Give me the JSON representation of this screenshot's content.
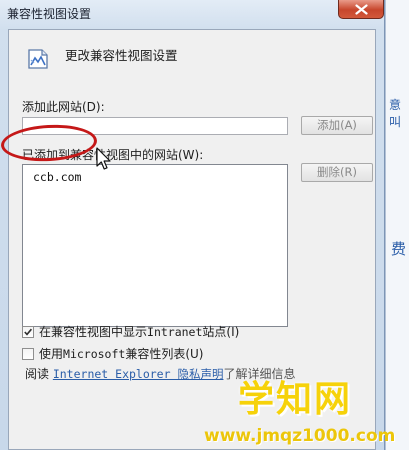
{
  "window": {
    "title": "兼容性视图设置"
  },
  "header": {
    "text": "更改兼容性视图设置"
  },
  "add_site": {
    "label": "添加此网站(D):",
    "input_value": "",
    "add_button": "添加(A)"
  },
  "site_list": {
    "label": "已添加到兼容性视图中的网站(W):",
    "items": [
      "ccb.com"
    ],
    "delete_button": "删除(R)"
  },
  "options": {
    "intranet": {
      "label_a": "在兼容性视图中显示 ",
      "label_mono": "Intranet",
      "label_b": " 站点(I)",
      "checked": true
    },
    "mslist": {
      "label_a": "使用 ",
      "label_mono": "Microsoft",
      "label_b": " 兼容性列表(U)",
      "checked": false
    }
  },
  "read_row": {
    "prefix": "阅读 ",
    "link": "Internet Explorer 隐私声明",
    "suffix": "了解详细信息"
  },
  "background": {
    "link_fragment": "意叫",
    "char": "费"
  },
  "watermark": {
    "title": "学知网",
    "url": "www.jmqz1000.com"
  },
  "colors": {
    "annotation_red": "#c51818",
    "link_blue": "#2a5da8",
    "watermark_yellow": "#f6d20a"
  },
  "icons": [
    "compatibility-view-icon",
    "close-icon",
    "mouse-pointer-icon",
    "check-icon"
  ]
}
